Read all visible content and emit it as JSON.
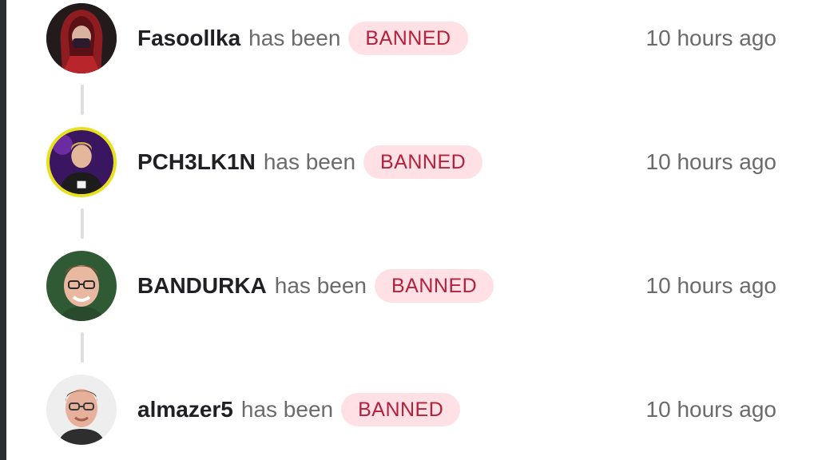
{
  "events": [
    {
      "username": "Fasoollka",
      "action": "has been",
      "badge": "BANNED",
      "time": "10 hours ago"
    },
    {
      "username": "PCH3LK1N",
      "action": "has been",
      "badge": "BANNED",
      "time": "10 hours ago"
    },
    {
      "username": "BANDURKA",
      "action": "has been",
      "badge": "BANNED",
      "time": "10 hours ago"
    },
    {
      "username": "almazer5",
      "action": "has been",
      "badge": "BANNED",
      "time": "10 hours ago"
    }
  ],
  "colors": {
    "badge_bg": "#ffe1e5",
    "badge_text": "#b3213d",
    "sidebar_edge": "#2b2d33"
  }
}
